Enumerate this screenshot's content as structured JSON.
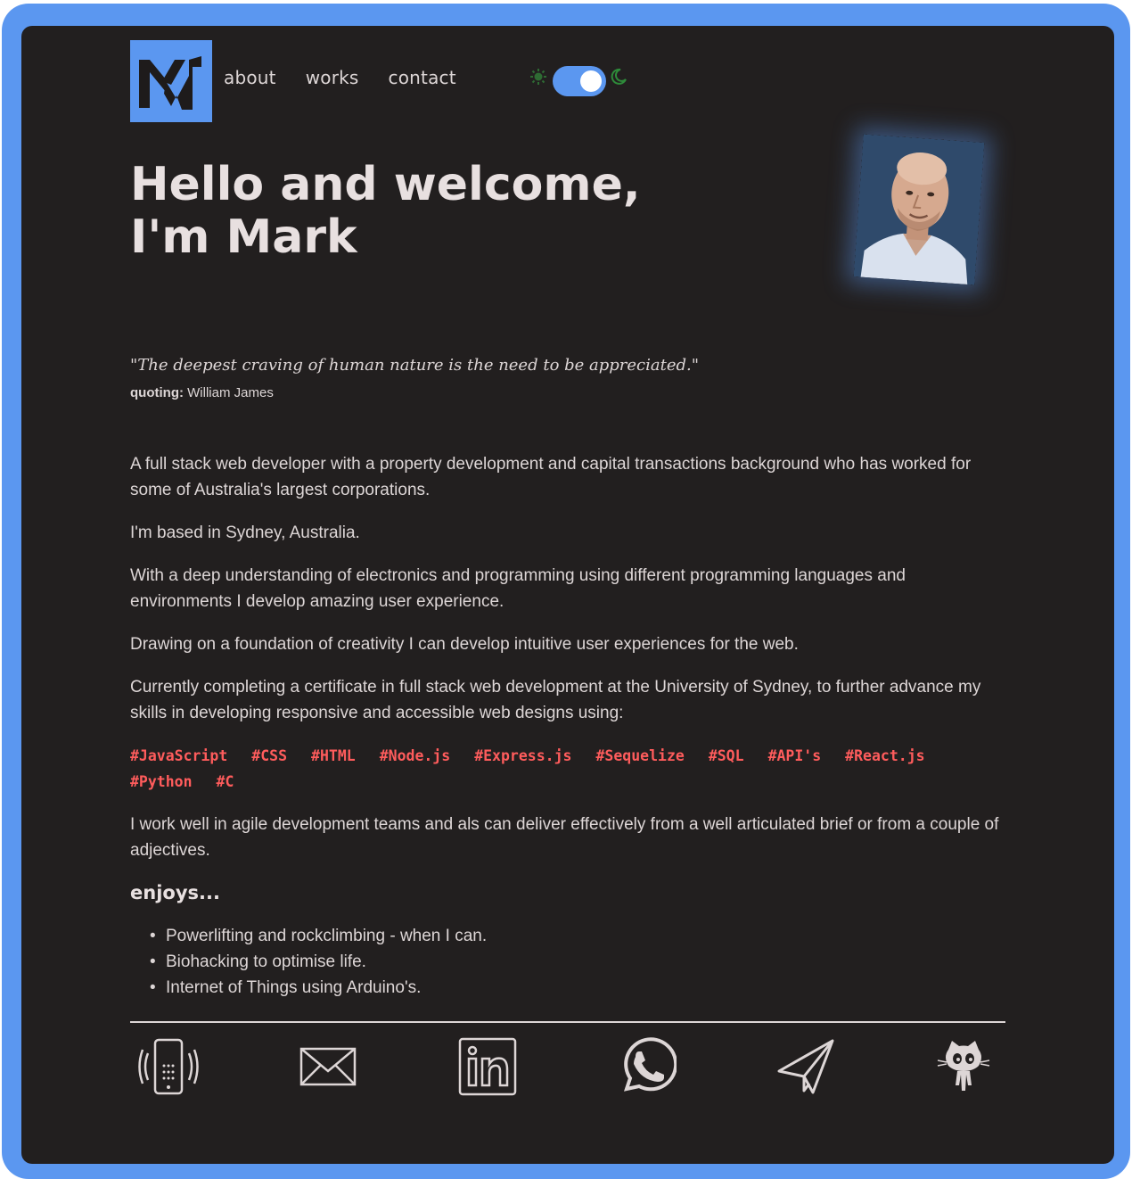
{
  "header": {
    "logo_alt": "MW logo",
    "nav": [
      {
        "label": "about"
      },
      {
        "label": "works"
      },
      {
        "label": "contact"
      }
    ],
    "theme_toggle": {
      "state": "dark"
    }
  },
  "hero": {
    "title_line1": "Hello and welcome,",
    "title_line2": "I'm Mark"
  },
  "quote": {
    "text": "\"The deepest craving of human nature is the need to be appreciated.\"",
    "prefix": "quoting:",
    "author": " William James"
  },
  "about": {
    "p1": "A full stack web developer with a property development and capital transactions background who has worked for some of Australia's largest corporations.",
    "p2": "I'm based in Sydney, Australia.",
    "p3": "With a deep understanding of electronics and programming using different programming languages and environments I develop amazing user experience.",
    "p4": "Drawing on a foundation of creativity I can develop intuitive user experiences for the web.",
    "p5": "Currently completing a certificate in full stack web development at the University of Sydney, to further advance my skills in developing responsive and accessible web designs using:",
    "skills": [
      "#JavaScript",
      "#CSS",
      "#HTML",
      "#Node.js",
      "#Express.js",
      "#Sequelize",
      "#SQL",
      "#API's",
      "#React.js",
      "#Python",
      "#C"
    ],
    "p6": "I work well in agile development teams and als can deliver effectively from a well articulated brief or from a couple of adjectives.",
    "enjoys_heading": "enjoys...",
    "enjoys": [
      "Powerlifting and rockclimbing - when I can.",
      "Biohacking to optimise life.",
      "Internet of Things using Arduino's."
    ]
  },
  "socials": [
    {
      "icon": "phone-icon"
    },
    {
      "icon": "email-icon"
    },
    {
      "icon": "linkedin-icon"
    },
    {
      "icon": "whatsapp-icon"
    },
    {
      "icon": "telegram-icon"
    },
    {
      "icon": "github-icon"
    }
  ],
  "colors": {
    "accent": "#5b97f0",
    "background": "#221f1f",
    "text": "#ddd6d6",
    "skill": "#ff5c5c",
    "toggle_icons": "#2e8b3a"
  }
}
